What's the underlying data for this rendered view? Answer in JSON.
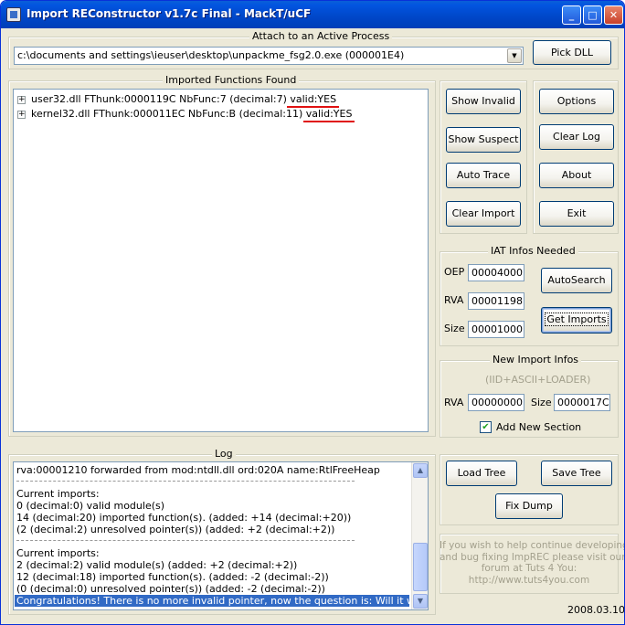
{
  "window": {
    "title": "Import REConstructor v1.7c Final - MackT/uCF",
    "minimize": "_",
    "maximize": "□",
    "close": "✕"
  },
  "attach": {
    "label": "Attach to an Active Process",
    "process": "c:\\documents and settings\\ieuser\\desktop\\unpackme_fsg2.0.exe (000001E4)",
    "dropdown_glyph": "▼",
    "pick_dll": "Pick DLL"
  },
  "imports": {
    "label": "Imported Functions Found",
    "rows": [
      {
        "expander": "+",
        "text": "user32.dll FThunk:0000119C NbFunc:7 (decimal:7) ",
        "valid": "valid:YES"
      },
      {
        "expander": "+",
        "text": "kernel32.dll FThunk:000011EC NbFunc:B (decimal:11) ",
        "valid": "valid:YES"
      }
    ]
  },
  "buttons": {
    "show_invalid": "Show Invalid",
    "show_suspect": "Show Suspect",
    "auto_trace": "Auto Trace",
    "clear_import": "Clear Import",
    "options": "Options",
    "clear_log": "Clear Log",
    "about": "About",
    "exit": "Exit",
    "autosearch": "AutoSearch",
    "get_imports": "Get Imports",
    "load_tree": "Load Tree",
    "save_tree": "Save Tree",
    "fix_dump": "Fix Dump"
  },
  "iat": {
    "label": "IAT Infos Needed",
    "oep_label": "OEP",
    "oep": "00004000",
    "rva_label": "RVA",
    "rva": "00001198",
    "size_label": "Size",
    "size": "00001000"
  },
  "new_import": {
    "label": "New Import Infos",
    "hint": "(IID+ASCII+LOADER)",
    "rva_label": "RVA",
    "rva": "00000000",
    "size_label": "Size",
    "size": "0000017C",
    "add_section_label": "Add New Section",
    "add_section_checked": true,
    "check_glyph": "✔"
  },
  "log": {
    "label": "Log",
    "lines": [
      "rva:00001210 forwarded from mod:ntdll.dll ord:020A name:RtlFreeHeap",
      "---",
      "Current imports:",
      "0 (decimal:0) valid module(s)",
      "14 (decimal:20) imported function(s). (added: +14 (decimal:+20))",
      "(2 (decimal:2) unresolved pointer(s)) (added: +2 (decimal:+2))",
      "---",
      "Current imports:",
      "2 (decimal:2) valid module(s) (added: +2 (decimal:+2))",
      "12 (decimal:18) imported function(s). (added: -2 (decimal:-2))",
      "(0 (decimal:0) unresolved pointer(s)) (added: -2 (decimal:-2))",
      "Congratulations! There is no more invalid pointer, now the question is: Will it work? :-)"
    ],
    "scroll_up": "▲",
    "scroll_down": "▼"
  },
  "info": {
    "line1": "If you wish to help continue developing",
    "line2": "and bug fixing ImpREC please visit our",
    "line3": "forum at Tuts 4 You:",
    "line4": "http://www.tuts4you.com"
  },
  "version_date": "2008.03.10"
}
